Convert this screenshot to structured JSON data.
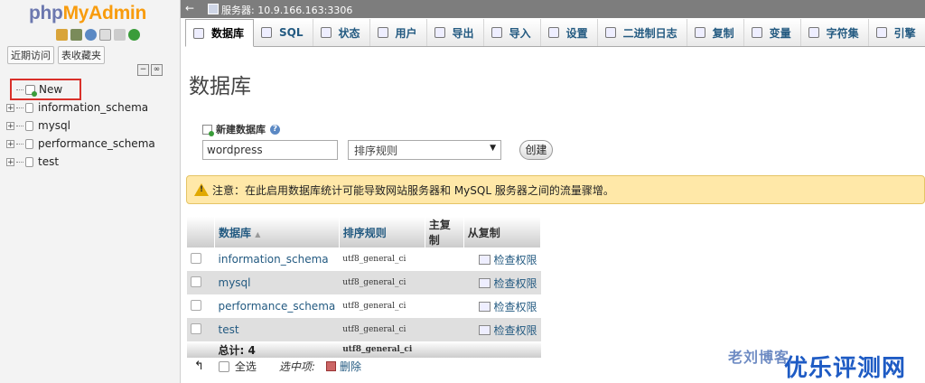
{
  "logo": {
    "php": "php",
    "my": "My",
    "admin": "Admin"
  },
  "nav": {
    "recent": "近期访问",
    "favorites": "表收藏夹",
    "new": "New",
    "databases": [
      "information_schema",
      "mysql",
      "performance_schema",
      "test"
    ]
  },
  "topbar": {
    "back": "←",
    "server": "服务器: 10.9.166.163:3306"
  },
  "tabs": [
    {
      "label": "数据库",
      "icon": "database-icon"
    },
    {
      "label": "SQL",
      "icon": "sql-icon"
    },
    {
      "label": "状态",
      "icon": "status-icon"
    },
    {
      "label": "用户",
      "icon": "users-icon"
    },
    {
      "label": "导出",
      "icon": "export-icon"
    },
    {
      "label": "导入",
      "icon": "import-icon"
    },
    {
      "label": "设置",
      "icon": "wrench-icon"
    },
    {
      "label": "二进制日志",
      "icon": "binlog-icon"
    },
    {
      "label": "复制",
      "icon": "replication-icon"
    },
    {
      "label": "变量",
      "icon": "variables-icon"
    },
    {
      "label": "字符集",
      "icon": "charset-icon"
    },
    {
      "label": "引擎",
      "icon": "engine-icon"
    }
  ],
  "main": {
    "title": "数据库",
    "create_label": "新建数据库",
    "dbname_value": "wordpress",
    "collation_value": "排序规则",
    "create_button": "创建",
    "notice": "注意：在此启用数据库统计可能导致网站服务器和 MySQL 服务器之间的流量骤增。"
  },
  "table": {
    "headers": {
      "db": "数据库",
      "db_sort": "▲",
      "collation": "排序规则",
      "master": "主复制",
      "slave": "从复制"
    },
    "rows": [
      {
        "name": "information_schema",
        "collation": "utf8_general_ci",
        "action": "检查权限"
      },
      {
        "name": "mysql",
        "collation": "utf8_general_ci",
        "action": "检查权限"
      },
      {
        "name": "performance_schema",
        "collation": "utf8_general_ci",
        "action": "检查权限"
      },
      {
        "name": "test",
        "collation": "utf8_general_ci",
        "action": "检查权限"
      }
    ],
    "total_label": "总计: 4",
    "total_collation": "utf8_general_ci"
  },
  "footer": {
    "check_all": "全选",
    "with_selected": "选中项:",
    "delete": "删除"
  },
  "watermark": {
    "text1": "老刘博客",
    "text2": "优乐评测网"
  }
}
